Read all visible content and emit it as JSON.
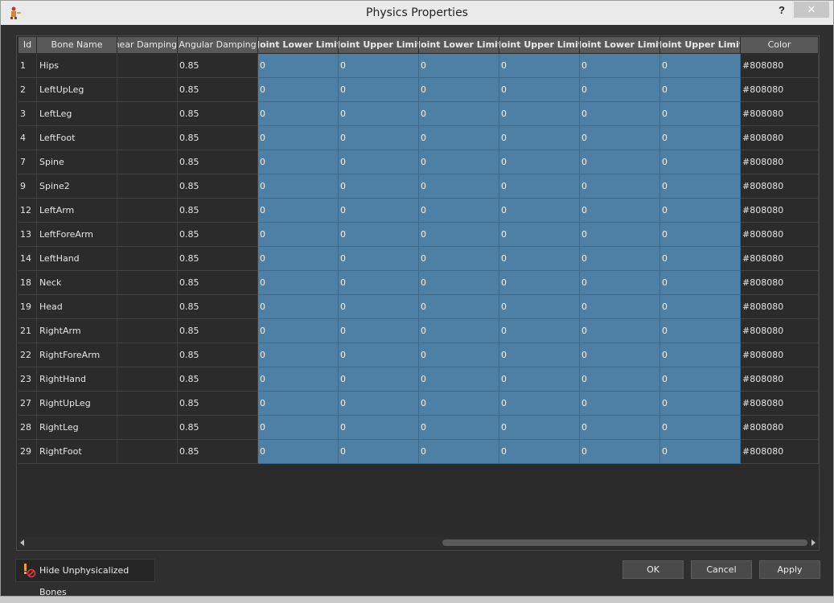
{
  "window": {
    "title": "Physics Properties",
    "help_label": "?",
    "close_label": "✕"
  },
  "columns": [
    {
      "label": "Id",
      "bold": false,
      "clip": "center"
    },
    {
      "label": "Bone Name",
      "bold": false,
      "clip": "center"
    },
    {
      "label": "Linear Damping",
      "bold": false,
      "clip": "left"
    },
    {
      "label": "Angular Damping",
      "bold": false,
      "clip": "center"
    },
    {
      "label": "Joint Lower Limit X",
      "bold": true,
      "clip": "both"
    },
    {
      "label": "Joint Upper Limit X",
      "bold": true,
      "clip": "both"
    },
    {
      "label": "Joint Lower Limit Y",
      "bold": true,
      "clip": "both"
    },
    {
      "label": "Joint Upper Limit Y",
      "bold": true,
      "clip": "both"
    },
    {
      "label": "Joint Lower Limit Z",
      "bold": true,
      "clip": "both"
    },
    {
      "label": "Joint Upper Limit Z",
      "bold": true,
      "clip": "both"
    },
    {
      "label": "Color",
      "bold": false,
      "clip": "center"
    }
  ],
  "rows": [
    {
      "id": "1",
      "name": "Hips",
      "linear_damping": "",
      "angular_damping": "0.85",
      "limits": [
        "0",
        "0",
        "0",
        "0",
        "0",
        "0"
      ],
      "color": "#808080"
    },
    {
      "id": "2",
      "name": "LeftUpLeg",
      "linear_damping": "",
      "angular_damping": "0.85",
      "limits": [
        "0",
        "0",
        "0",
        "0",
        "0",
        "0"
      ],
      "color": "#808080"
    },
    {
      "id": "3",
      "name": "LeftLeg",
      "linear_damping": "",
      "angular_damping": "0.85",
      "limits": [
        "0",
        "0",
        "0",
        "0",
        "0",
        "0"
      ],
      "color": "#808080"
    },
    {
      "id": "4",
      "name": "LeftFoot",
      "linear_damping": "",
      "angular_damping": "0.85",
      "limits": [
        "0",
        "0",
        "0",
        "0",
        "0",
        "0"
      ],
      "color": "#808080"
    },
    {
      "id": "7",
      "name": "Spine",
      "linear_damping": "",
      "angular_damping": "0.85",
      "limits": [
        "0",
        "0",
        "0",
        "0",
        "0",
        "0"
      ],
      "color": "#808080"
    },
    {
      "id": "9",
      "name": "Spine2",
      "linear_damping": "",
      "angular_damping": "0.85",
      "limits": [
        "0",
        "0",
        "0",
        "0",
        "0",
        "0"
      ],
      "color": "#808080"
    },
    {
      "id": "12",
      "name": "LeftArm",
      "linear_damping": "",
      "angular_damping": "0.85",
      "limits": [
        "0",
        "0",
        "0",
        "0",
        "0",
        "0"
      ],
      "color": "#808080"
    },
    {
      "id": "13",
      "name": "LeftForeArm",
      "linear_damping": "",
      "angular_damping": "0.85",
      "limits": [
        "0",
        "0",
        "0",
        "0",
        "0",
        "0"
      ],
      "color": "#808080"
    },
    {
      "id": "14",
      "name": "LeftHand",
      "linear_damping": "",
      "angular_damping": "0.85",
      "limits": [
        "0",
        "0",
        "0",
        "0",
        "0",
        "0"
      ],
      "color": "#808080"
    },
    {
      "id": "18",
      "name": "Neck",
      "linear_damping": "",
      "angular_damping": "0.85",
      "limits": [
        "0",
        "0",
        "0",
        "0",
        "0",
        "0"
      ],
      "color": "#808080"
    },
    {
      "id": "19",
      "name": "Head",
      "linear_damping": "",
      "angular_damping": "0.85",
      "limits": [
        "0",
        "0",
        "0",
        "0",
        "0",
        "0"
      ],
      "color": "#808080"
    },
    {
      "id": "21",
      "name": "RightArm",
      "linear_damping": "",
      "angular_damping": "0.85",
      "limits": [
        "0",
        "0",
        "0",
        "0",
        "0",
        "0"
      ],
      "color": "#808080"
    },
    {
      "id": "22",
      "name": "RightForeArm",
      "linear_damping": "",
      "angular_damping": "0.85",
      "limits": [
        "0",
        "0",
        "0",
        "0",
        "0",
        "0"
      ],
      "color": "#808080"
    },
    {
      "id": "23",
      "name": "RightHand",
      "linear_damping": "",
      "angular_damping": "0.85",
      "limits": [
        "0",
        "0",
        "0",
        "0",
        "0",
        "0"
      ],
      "color": "#808080"
    },
    {
      "id": "27",
      "name": "RightUpLeg",
      "linear_damping": "",
      "angular_damping": "0.85",
      "limits": [
        "0",
        "0",
        "0",
        "0",
        "0",
        "0"
      ],
      "color": "#808080"
    },
    {
      "id": "28",
      "name": "RightLeg",
      "linear_damping": "",
      "angular_damping": "0.85",
      "limits": [
        "0",
        "0",
        "0",
        "0",
        "0",
        "0"
      ],
      "color": "#808080"
    },
    {
      "id": "29",
      "name": "RightFoot",
      "linear_damping": "",
      "angular_damping": "0.85",
      "limits": [
        "0",
        "0",
        "0",
        "0",
        "0",
        "0"
      ],
      "color": "#808080"
    }
  ],
  "footer": {
    "hide_label": "Hide Unphysicalized Bones",
    "ok_label": "OK",
    "cancel_label": "Cancel",
    "apply_label": "Apply"
  },
  "colors": {
    "limit_cell": "#4e7fa4",
    "header": "#595959",
    "background": "#2f2f2f"
  }
}
